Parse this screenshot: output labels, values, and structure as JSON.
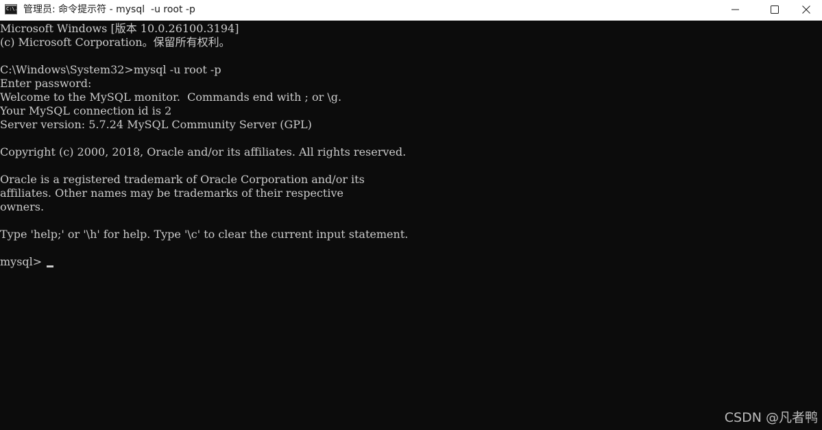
{
  "titlebar": {
    "app_icon_text": "C:\\.",
    "title": "管理员: 命令提示符 - mysql  -u root -p",
    "controls": {
      "minimize_icon": "minimize-icon",
      "maximize_icon": "maximize-icon",
      "close_icon": "close-icon"
    }
  },
  "console": {
    "lines": [
      "Microsoft Windows [版本 10.0.26100.3194]",
      "(c) Microsoft Corporation。保留所有权利。",
      "",
      "C:\\Windows\\System32>mysql -u root -p",
      "Enter password:",
      "Welcome to the MySQL monitor.  Commands end with ; or \\g.",
      "Your MySQL connection id is 2",
      "Server version: 5.7.24 MySQL Community Server (GPL)",
      "",
      "Copyright (c) 2000, 2018, Oracle and/or its affiliates. All rights reserved.",
      "",
      "Oracle is a registered trademark of Oracle Corporation and/or its",
      "affiliates. Other names may be trademarks of their respective",
      "owners.",
      "",
      "Type 'help;' or '\\h' for help. Type '\\c' to clear the current input statement.",
      "",
      "mysql> "
    ]
  },
  "watermark": "CSDN @凡者鸭",
  "colors": {
    "console_background": "#0c0c0c",
    "console_text": "#cccccc",
    "titlebar_background": "#ffffff"
  }
}
